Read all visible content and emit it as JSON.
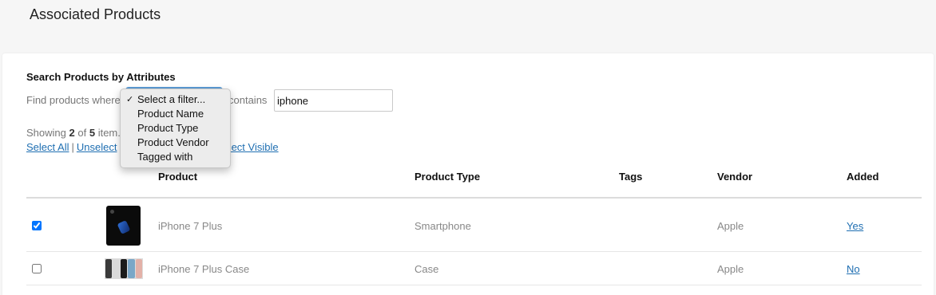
{
  "page": {
    "title": "Associated Products"
  },
  "search": {
    "heading": "Search Products by Attributes",
    "find_label": "Find products where",
    "contains_label": "contains",
    "query_value": "iphone",
    "filter_options": [
      "Select a filter...",
      "Product Name",
      "Product Type",
      "Product Vendor",
      "Tagged with"
    ],
    "filter_selected_index": 0,
    "filter_color": "#5b9bd5"
  },
  "results": {
    "showing_prefix": "Showing",
    "showing_count": "2",
    "showing_of": "of",
    "showing_total": "5",
    "showing_suffix": "item..."
  },
  "selection_links": {
    "select_all": "Select All",
    "separator": "|",
    "unselect": "Unselect",
    "select_visible": "elect Visible"
  },
  "table": {
    "columns": [
      "Product",
      "Product Type",
      "Tags",
      "Vendor",
      "Added"
    ],
    "rows": [
      {
        "checked": true,
        "thumbnail": "iphone-black-icon",
        "product": "iPhone 7 Plus",
        "type": "Smartphone",
        "tags": "",
        "vendor": "Apple",
        "added": "Yes"
      },
      {
        "checked": false,
        "thumbnail": "iphone-cases-icon",
        "product": "iPhone 7 Plus Case",
        "type": "Case",
        "tags": "",
        "vendor": "Apple",
        "added": "No"
      }
    ]
  },
  "colors": {
    "link": "#1f6fb2",
    "case_swatches": [
      "#3a3a3a",
      "#d9d9d9",
      "#1b1b1b",
      "#7aa7c7",
      "#e3b1a8"
    ]
  }
}
